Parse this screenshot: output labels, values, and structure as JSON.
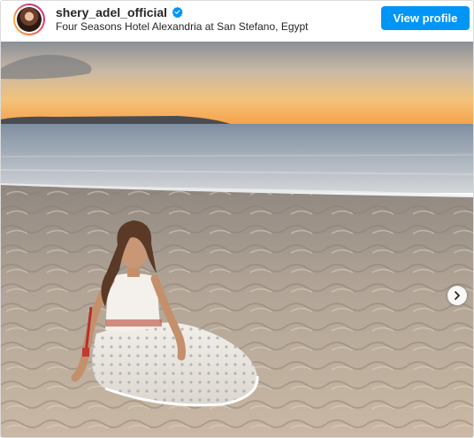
{
  "post": {
    "username": "shery_adel_official",
    "location": "Four Seasons Hotel Alexandria at San Stefano, Egypt",
    "verified": true
  },
  "actions": {
    "view_profile_label": "View profile"
  },
  "icons": {
    "verified": "verified-badge-icon",
    "next": "chevron-right-icon"
  },
  "colors": {
    "accent": "#0095f6",
    "text": "#262626",
    "border": "#dbdbdb"
  }
}
